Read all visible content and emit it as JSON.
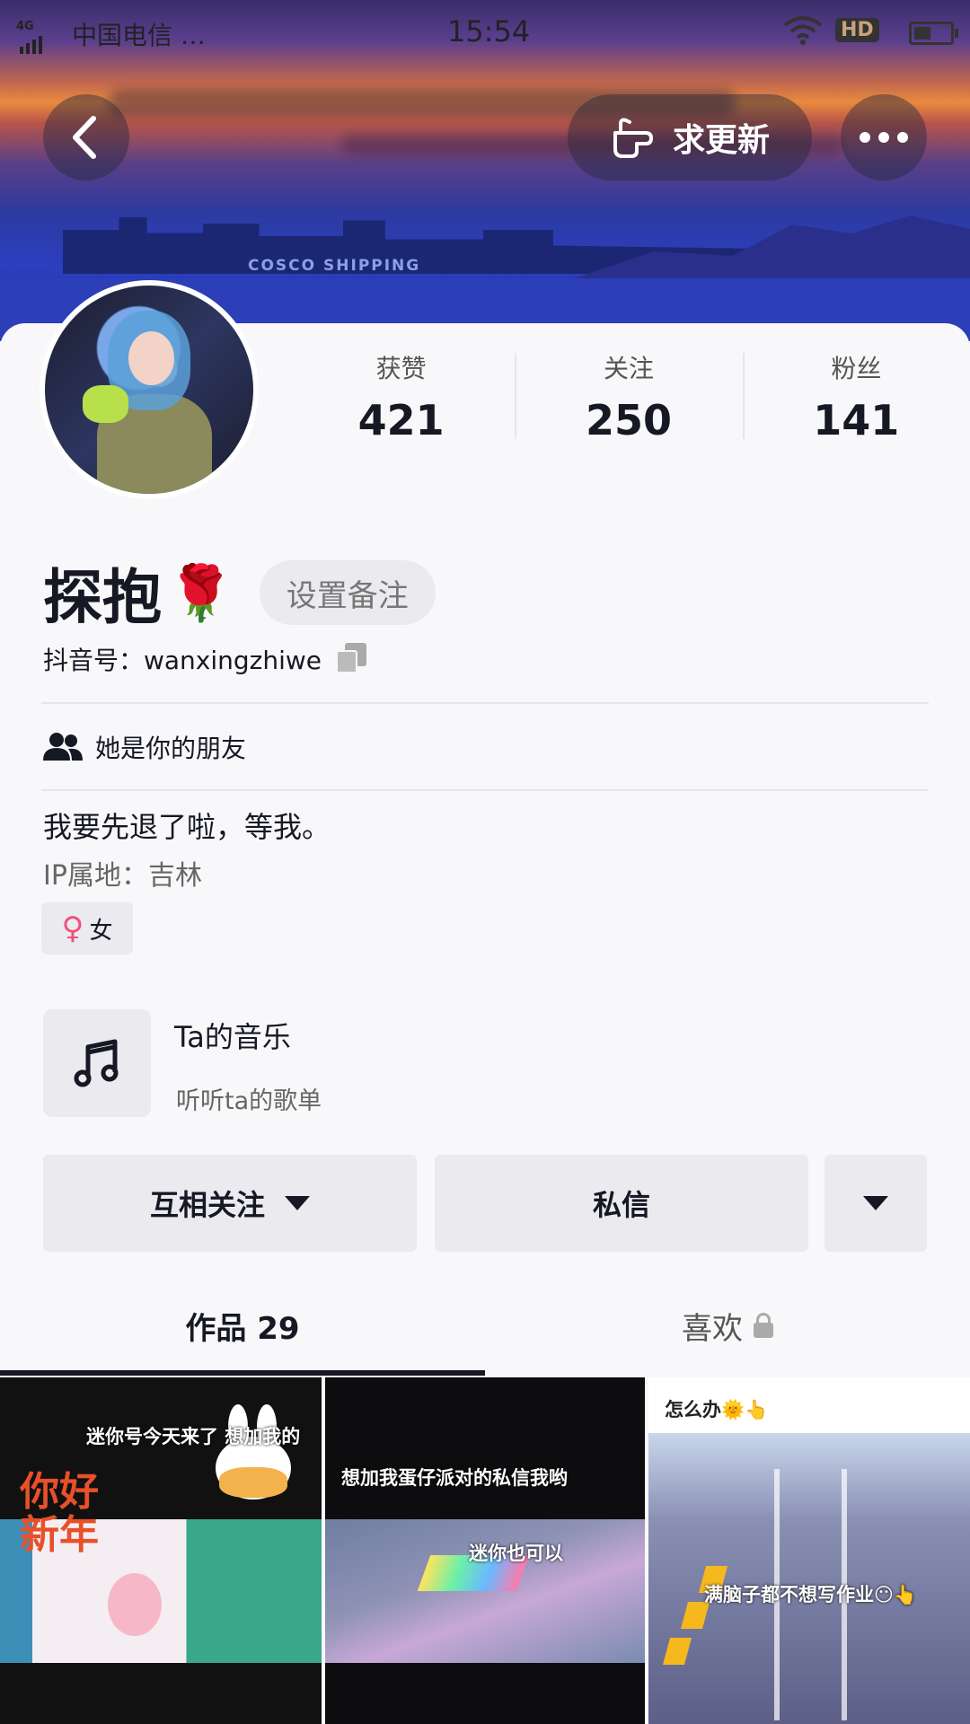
{
  "status_bar": {
    "network": "4G",
    "carrier": "中国电信 …",
    "time": "15:54",
    "hd_badge": "HD"
  },
  "banner": {
    "ship_text": "COSCO SHIPPING"
  },
  "header": {
    "update_label": "求更新"
  },
  "stats": [
    {
      "label": "获赞",
      "value": "421"
    },
    {
      "label": "关注",
      "value": "250"
    },
    {
      "label": "粉丝",
      "value": "141"
    }
  ],
  "profile": {
    "name": "探抱",
    "name_emoji": "🌹",
    "remark_button": "设置备注",
    "douyin_id": "抖音号：wanxingzhiwe",
    "friend_text": "她是你的朋友",
    "bio": "我要先退了啦，等我。",
    "ip": "IP属地：吉林",
    "gender_symbol": "♀",
    "gender": "女"
  },
  "music": {
    "title": "Ta的音乐",
    "subtitle": "听听ta的歌单"
  },
  "actions": {
    "follow": "互相关注",
    "message": "私信"
  },
  "tabs": [
    {
      "label": "作品 29"
    },
    {
      "label": "喜欢"
    }
  ],
  "videos": [
    {
      "caption": "迷你号今天来了 想加我的",
      "overlay": "你好 新年"
    },
    {
      "caption_top": "想加我蛋仔派对的私信我哟",
      "caption_bottom": "迷你也可以"
    },
    {
      "caption_top": "怎么办🌞👆",
      "caption_bottom": "满脑子都不想写作业😶👆"
    }
  ],
  "colors": {
    "text_primary": "#161823",
    "button_bg": "#ebebef",
    "page_bg": "#f8f8fa",
    "gender_pink": "#f0507c"
  }
}
